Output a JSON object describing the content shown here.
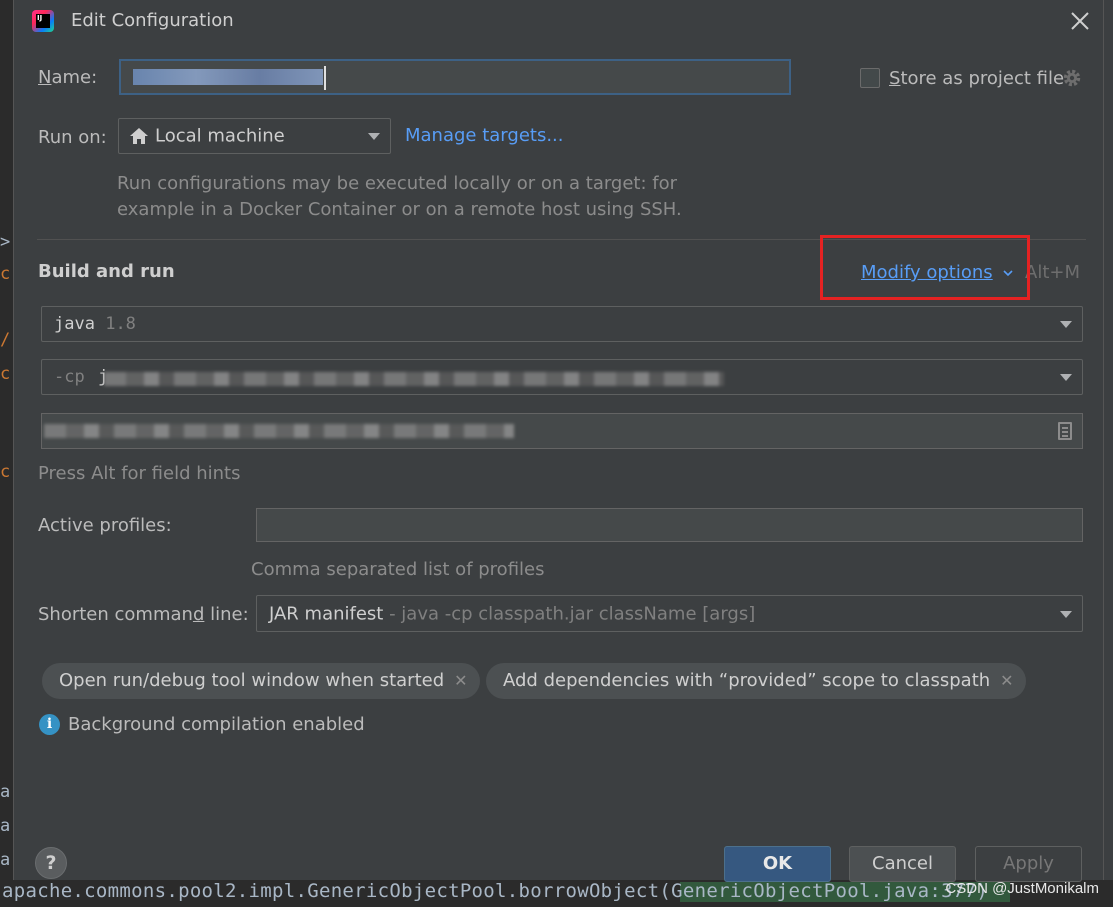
{
  "window": {
    "title": "Edit Configuration"
  },
  "name": {
    "label": "Name:",
    "value": ""
  },
  "store": {
    "label": "Store as project file"
  },
  "run_on": {
    "label": "Run on:",
    "value": "Local machine",
    "manage_link": "Manage targets...",
    "hint_line1": "Run configurations may be executed locally or on a target: for",
    "hint_line2": "example in a Docker Container or on a remote host using SSH."
  },
  "build_and_run": {
    "title": "Build and run",
    "modify_options": "Modify options",
    "modify_shortcut": "Alt+M",
    "jre": {
      "name": "java",
      "version": "1.8"
    },
    "classpath_prefix": "-cp",
    "classpath_start": "j",
    "field_hint": "Press Alt for field hints"
  },
  "active_profiles": {
    "label": "Active profiles:",
    "value": "",
    "hint": "Comma separated list of profiles"
  },
  "shorten": {
    "label": "Shorten command line:",
    "value": "JAR manifest",
    "value_desc": " - java -cp classpath.jar className [args]"
  },
  "chips": [
    {
      "label": "Open run/debug tool window when started"
    },
    {
      "label": "Add dependencies with “provided” scope to classpath"
    }
  ],
  "info": {
    "text": "Background compilation enabled"
  },
  "buttons": {
    "ok": "OK",
    "cancel": "Cancel",
    "apply": "Apply",
    "help": "?"
  },
  "background": {
    "bottom_code": "apache.commons.pool2.impl.GenericObjectPool.borrowObject(GenericObjectPool.java:377)",
    "watermark": "CSDN @JustMonikalm"
  },
  "colors": {
    "accent": "#589df6",
    "ok_button": "#365880",
    "highlight_box": "#e52222",
    "info": "#3592c4"
  }
}
